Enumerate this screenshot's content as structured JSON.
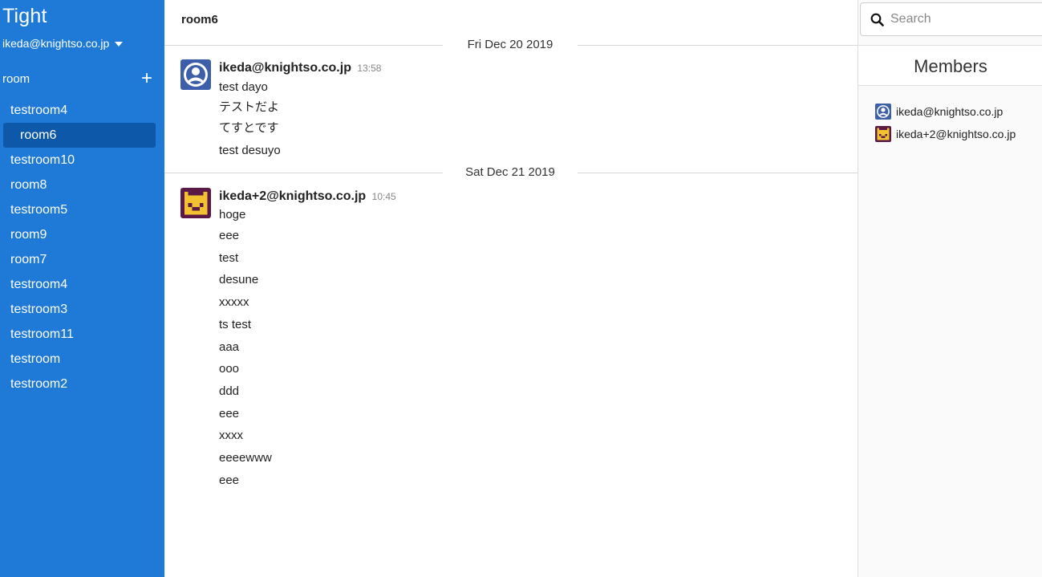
{
  "app": {
    "title": "Tight"
  },
  "user": {
    "email": "ikeda@knightso.co.jp"
  },
  "sidebar": {
    "section_label": "room",
    "add_label": "+",
    "rooms": [
      {
        "label": "testroom4"
      },
      {
        "label": "room6",
        "active": true
      },
      {
        "label": "testroom10"
      },
      {
        "label": "room8"
      },
      {
        "label": "testroom5"
      },
      {
        "label": "room9"
      },
      {
        "label": "room7"
      },
      {
        "label": "testroom4"
      },
      {
        "label": "testroom3"
      },
      {
        "label": "testroom11"
      },
      {
        "label": "testroom"
      },
      {
        "label": "testroom2"
      }
    ]
  },
  "main": {
    "room_name": "room6",
    "days": [
      {
        "date": "Fri Dec 20 2019",
        "groups": [
          {
            "author": "ikeda@knightso.co.jp",
            "time": "13:58",
            "avatar": "person-avatar-icon",
            "lines": [
              "test dayo",
              "テストだよ",
              "てすとです",
              "test desuyo"
            ]
          }
        ]
      },
      {
        "date": "Sat Dec 21 2019",
        "groups": [
          {
            "author": "ikeda+2@knightso.co.jp",
            "time": "10:45",
            "avatar": "pixel-face-avatar-icon",
            "lines": [
              "hoge",
              "eee",
              "test",
              "desune",
              "xxxxx",
              "ts test",
              "aaa",
              "ooo",
              "ddd",
              "eee",
              "xxxx",
              "eeeewww",
              "eee"
            ]
          }
        ]
      }
    ]
  },
  "right": {
    "search_placeholder": "Search",
    "members_title": "Members",
    "members": [
      {
        "name": "ikeda@knightso.co.jp",
        "avatar": "person-avatar-icon"
      },
      {
        "name": "ikeda+2@knightso.co.jp",
        "avatar": "pixel-face-avatar-icon"
      }
    ]
  },
  "colors": {
    "sidebar_bg": "#1e7ad6",
    "sidebar_active": "#0d58a8",
    "avatar_blue": "#3d5ea8",
    "avatar_purple": "#5b1a45",
    "avatar_yellow": "#f2c230"
  }
}
